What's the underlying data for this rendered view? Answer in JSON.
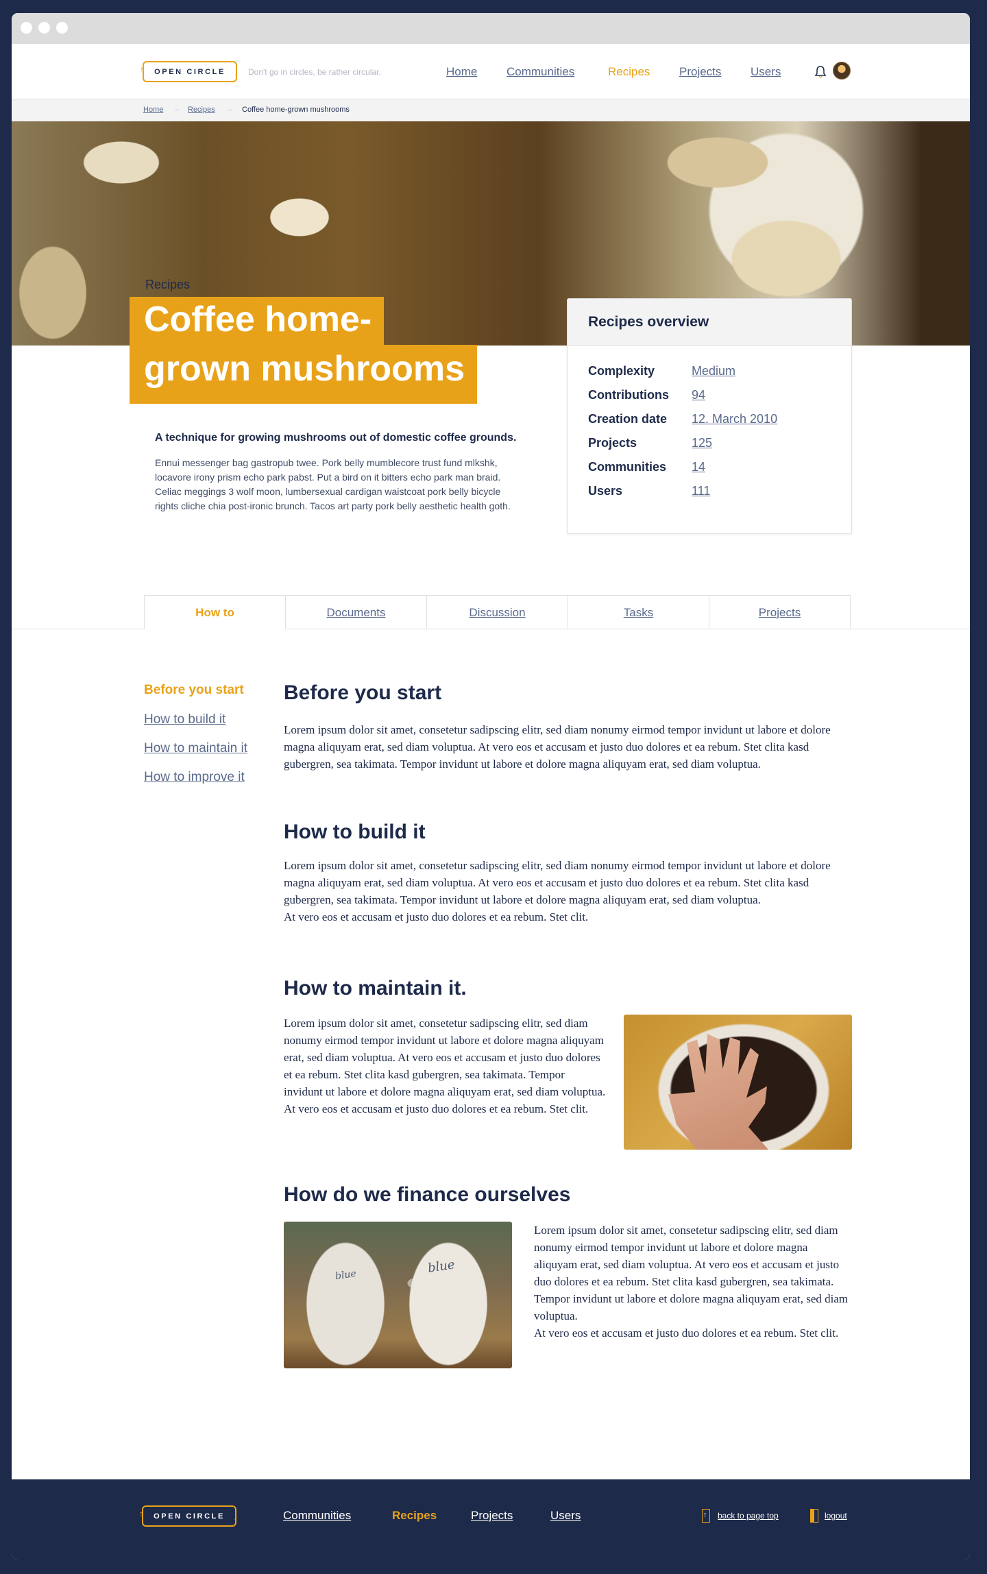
{
  "header": {
    "logo_text": "OPEN CIRCLE",
    "tagline": "Don't go in circles, be rather circular.",
    "nav": [
      "Home",
      "Communities",
      "Recipes",
      "Projects",
      "Users"
    ],
    "active_nav": "Recipes"
  },
  "breadcrumb": [
    "Home",
    "Recipes",
    "Coffee home-grown mushrooms"
  ],
  "hero": {
    "section_label": "Recipes",
    "title_line1": "Coffee home-",
    "title_line2": "grown mushrooms"
  },
  "intro": {
    "subtitle": "A technique for growing mushrooms out of domestic coffee grounds.",
    "text": "Ennui messenger bag gastropub twee. Pork belly mumblecore trust fund mlkshk, locavore irony prism echo park pabst. Put a bird on it bitters echo park man braid. Celiac meggings 3 wolf moon, lumbersexual cardigan waistcoat pork belly bicycle rights cliche chia post-ironic brunch. Tacos art party pork belly aesthetic health goth."
  },
  "overview": {
    "title": "Recipes overview",
    "rows": [
      {
        "label": "Complexity",
        "value": "Medium"
      },
      {
        "label": "Contributions",
        "value": "94"
      },
      {
        "label": "Creation date",
        "value": "12. March 2010"
      },
      {
        "label": "Projects",
        "value": "125"
      },
      {
        "label": "Communities",
        "value": "14"
      },
      {
        "label": "Users",
        "value": "111"
      }
    ]
  },
  "tabs": [
    "How to",
    "Documents",
    "Discussion",
    "Tasks",
    "Projects"
  ],
  "side_nav": [
    "Before you start",
    "How to build it",
    "How to maintain it",
    "How to improve it"
  ],
  "sections": {
    "s1_title": "Before you start",
    "s1_text": "Lorem ipsum dolor sit amet, consetetur sadipscing elitr, sed diam nonumy eirmod tempor invidunt ut labore et dolore magna aliquyam erat, sed diam voluptua. At vero eos et accusam et justo duo dolores et ea rebum. Stet clita kasd gubergren, sea takimata. Tempor invidunt ut labore et dolore magna aliquyam erat, sed diam voluptua.",
    "s2_title": "How to build it",
    "s2_text": "Lorem ipsum dolor sit amet, consetetur sadipscing elitr, sed diam nonumy eirmod tempor invidunt ut labore et dolore magna aliquyam erat, sed diam voluptua. At vero eos et accusam et justo duo dolores et ea rebum. Stet clita kasd gubergren, sea takimata. Tempor invidunt ut labore et dolore magna aliquyam erat, sed diam voluptua.",
    "s2_text2": "At vero eos et accusam et justo duo dolores et ea rebum. Stet clit.",
    "s3_title": "How to maintain it.",
    "s3_text": "Lorem ipsum dolor sit amet, consetetur sadipscing elitr, sed diam nonumy eirmod tempor invidunt ut labore et dolore magna aliquyam erat, sed diam voluptua. At vero eos et accusam et justo duo dolores et ea rebum. Stet clita kasd gubergren, sea takimata. Tempor invidunt ut labore et dolore magna aliquyam erat, sed diam voluptua.",
    "s3_text2": "At vero eos et accusam et justo duo dolores et ea rebum. Stet clit.",
    "s4_title": "How do we finance ourselves",
    "s4_text": "Lorem ipsum dolor sit amet, consetetur sadipscing elitr, sed diam nonumy eirmod tempor invidunt ut labore et dolore magna aliquyam erat, sed diam voluptua. At vero eos et accusam et justo duo dolores et ea rebum. Stet clita kasd gubergren, sea takimata. Tempor invidunt ut labore et dolore magna aliquyam erat, sed diam voluptua.",
    "s4_text2": "At vero eos et accusam et justo duo dolores et ea rebum. Stet clit."
  },
  "images": {
    "bag_text1": "blue",
    "bag_text2": "blue"
  },
  "footer": {
    "logo_text": "OPEN CIRCLE",
    "nav": [
      "Communities",
      "Recipes",
      "Projects",
      "Users"
    ],
    "back_to_top": "back to page top",
    "logout": "logout"
  },
  "colors": {
    "accent": "#e8a21a",
    "navy": "#1e2a4a",
    "link": "#5a6a8c"
  },
  "icons": [
    "bell-icon",
    "avatar",
    "arrow-up-icon",
    "logout-icon"
  ]
}
